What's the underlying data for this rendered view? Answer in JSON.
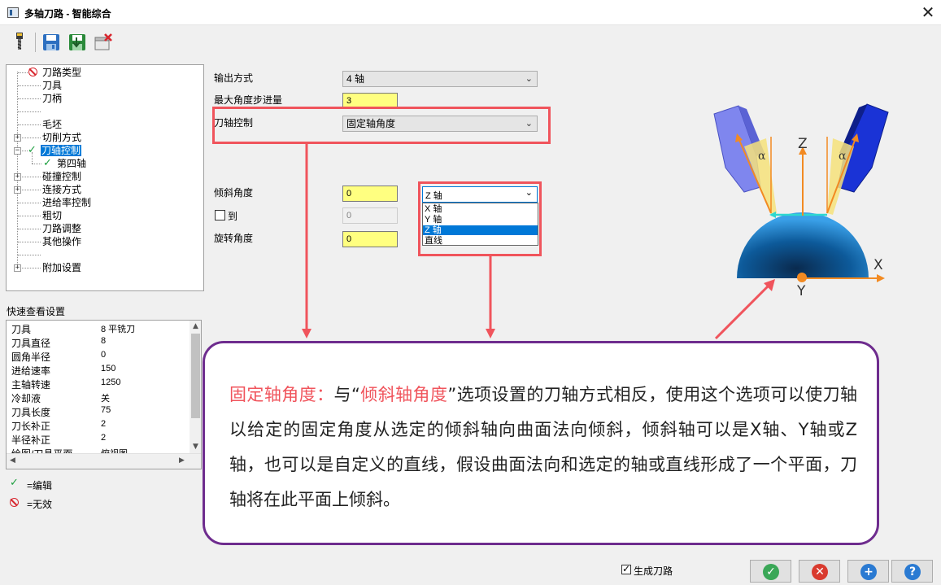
{
  "window": {
    "title": "多轴刀路 - 智能综合",
    "close_glyph": "✕"
  },
  "toolbar": {
    "buttons": [
      {
        "icon": "tool-icon",
        "tooltip": ""
      },
      {
        "icon": "save-icon"
      },
      {
        "icon": "save-as-icon"
      },
      {
        "icon": "delete-icon"
      }
    ]
  },
  "tree": {
    "items": [
      {
        "label": "刀路类型",
        "status": "invalid"
      },
      {
        "label": "刀具"
      },
      {
        "label": "刀柄"
      },
      {
        "label": ""
      },
      {
        "label": "毛坯"
      },
      {
        "label": "切削方式",
        "expandable": true
      },
      {
        "label": "刀轴控制",
        "expandable": true,
        "status": "edited",
        "selected": true
      },
      {
        "label": "第四轴",
        "status": "edited"
      },
      {
        "label": "碰撞控制",
        "expandable": true
      },
      {
        "label": "连接方式",
        "expandable": true
      },
      {
        "label": "进给率控制"
      },
      {
        "label": "粗切"
      },
      {
        "label": "刀路调整"
      },
      {
        "label": "其他操作"
      },
      {
        "label": ""
      },
      {
        "label": "附加设置",
        "expandable": true
      }
    ]
  },
  "quick_view": {
    "title": "快速查看设置",
    "rows": [
      {
        "key": "刀具",
        "value": "8 平铣刀"
      },
      {
        "key": "刀具直径",
        "value": "8"
      },
      {
        "key": "圆角半径",
        "value": "0"
      },
      {
        "key": "进给速率",
        "value": "150"
      },
      {
        "key": "主轴转速",
        "value": "1250"
      },
      {
        "key": "冷却液",
        "value": "关"
      },
      {
        "key": "刀具长度",
        "value": "75"
      },
      {
        "key": "刀长补正",
        "value": "2"
      },
      {
        "key": "半径补正",
        "value": "2"
      },
      {
        "key": "绘图/刀具平面",
        "value": "俯视图"
      }
    ]
  },
  "legend": {
    "edited": "=编辑",
    "invalid": "=无效"
  },
  "form": {
    "output_mode_label": "输出方式",
    "output_mode_value": "4 轴",
    "max_angle_step_label": "最大角度步进量",
    "max_angle_step_value": "3",
    "tool_axis_control_label": "刀轴控制",
    "tool_axis_control_value": "固定轴角度",
    "tilt_angle_label": "倾斜角度",
    "tilt_angle_value": "0",
    "to_label": "到",
    "to_value": "0",
    "rotation_angle_label": "旋转角度",
    "rotation_angle_value": "0",
    "tilt_axis_value": "Z 轴",
    "tilt_axis_options": [
      "X 轴",
      "Y 轴",
      "Z 轴",
      "直线"
    ],
    "tilt_axis_selected_index": 2
  },
  "diagram": {
    "z_label": "Z",
    "x_label": "X",
    "y_label": "Y",
    "alpha": "α",
    "colors": {
      "dome": "#0d6fb8",
      "tool_left": "#7f86ee",
      "tool_right": "#1a33d6",
      "arrow": "#f28a22",
      "cyan": "#2ed8d0",
      "wedge": "#f6e27a"
    }
  },
  "note": {
    "term": "固定轴角度：",
    "seg1": "与“",
    "ref": "倾斜轴角度",
    "seg2": "”选项设置的刀轴方式相反，使用这个选项可以使刀轴以给定的固定角度从选定的倾斜轴向曲面法向倾斜，倾斜轴可以是X轴、Y轴或Z轴，也可以是自定义的直线，假设曲面法向和选定的轴或直线形成了一个平面，刀轴将在此平面上倾斜。"
  },
  "footer": {
    "generate_toolpath_label": "生成刀路",
    "generate_toolpath_checked": true,
    "buttons": [
      {
        "name": "ok",
        "icon": "check-icon",
        "color": "#3aa757"
      },
      {
        "name": "cancel",
        "icon": "x-icon",
        "color": "#d93a2e"
      },
      {
        "name": "apply",
        "icon": "plus-icon",
        "color": "#2a7ad2"
      },
      {
        "name": "help",
        "icon": "question-icon",
        "color": "#2a7ad2"
      }
    ]
  },
  "colors": {
    "callout_red": "#f0545c",
    "note_border": "#6e2c8e",
    "selection": "#0078d7",
    "field_yellow": "#ffff80"
  }
}
